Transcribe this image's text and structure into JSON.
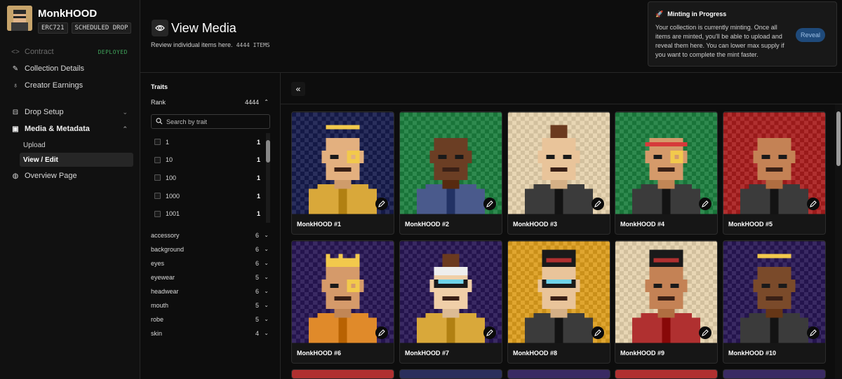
{
  "brand": {
    "name": "MonkHOOD",
    "tags": [
      "ERC721",
      "SCHEDULED DROP"
    ]
  },
  "nav": {
    "contract": {
      "label": "Contract",
      "badge": "DEPLOYED"
    },
    "collection_details": "Collection Details",
    "creator_earnings": "Creator Earnings",
    "drop_setup": "Drop Setup",
    "media_metadata": "Media & Metadata",
    "upload": "Upload",
    "view_edit": "View / Edit",
    "overview_page": "Overview Page"
  },
  "header": {
    "title": "View Media",
    "subtitle": "Review individual items here.",
    "item_count": "4444 ITEMS"
  },
  "mint_notice": {
    "title": "Minting in Progress",
    "text": "Your collection is currently minting. Once all items are minted, you'll be able to upload and reveal them here. You can lower max supply if you want to complete the mint faster.",
    "button": "Reveal"
  },
  "traits": {
    "title": "Traits",
    "rank": {
      "label": "Rank",
      "count": "4444"
    },
    "search_placeholder": "Search by trait",
    "rank_options": [
      {
        "label": "1",
        "count": "1"
      },
      {
        "label": "10",
        "count": "1"
      },
      {
        "label": "100",
        "count": "1"
      },
      {
        "label": "1000",
        "count": "1"
      },
      {
        "label": "1001",
        "count": "1"
      }
    ],
    "categories": [
      {
        "label": "accessory",
        "count": "6"
      },
      {
        "label": "background",
        "count": "6"
      },
      {
        "label": "eyes",
        "count": "6"
      },
      {
        "label": "eyewear",
        "count": "5"
      },
      {
        "label": "headwear",
        "count": "6"
      },
      {
        "label": "mouth",
        "count": "5"
      },
      {
        "label": "robe",
        "count": "5"
      },
      {
        "label": "skin",
        "count": "4"
      }
    ]
  },
  "items": [
    {
      "name": "MonkHOOD #1",
      "bg": "#2a2f5c",
      "skin": "#e3b07f",
      "robe": "#d9a83a",
      "head": "halo",
      "eyewear": "monocle"
    },
    {
      "name": "MonkHOOD #2",
      "bg": "#2f8a4f",
      "skin": "#6b3e24",
      "robe": "#4a5a8c",
      "head": "none",
      "eyewear": "none"
    },
    {
      "name": "MonkHOOD #3",
      "bg": "#e8d6b4",
      "skin": "#e9c49a",
      "robe": "#3b3b3b",
      "head": "bun",
      "eyewear": "none"
    },
    {
      "name": "MonkHOOD #4",
      "bg": "#2f8a4f",
      "skin": "#d59a6a",
      "robe": "#3b3b3b",
      "head": "headband",
      "eyewear": "monocle"
    },
    {
      "name": "MonkHOOD #5",
      "bg": "#b03030",
      "skin": "#c48255",
      "robe": "#3b3b3b",
      "head": "none",
      "eyewear": "none"
    },
    {
      "name": "MonkHOOD #6",
      "bg": "#3a2a63",
      "skin": "#d59a6a",
      "robe": "#e08a2a",
      "head": "crown",
      "eyewear": "monocle"
    },
    {
      "name": "MonkHOOD #7",
      "bg": "#3a2a63",
      "skin": "#f0cfa8",
      "robe": "#d9a83a",
      "head": "band",
      "eyewear": "visor"
    },
    {
      "name": "MonkHOOD #8",
      "bg": "#e0a630",
      "skin": "#e9c49a",
      "robe": "#3b3b3b",
      "head": "tophat",
      "eyewear": "visor"
    },
    {
      "name": "MonkHOOD #9",
      "bg": "#e8d6b4",
      "skin": "#c48255",
      "robe": "#b03030",
      "head": "tophat",
      "eyewear": "none"
    },
    {
      "name": "MonkHOOD #10",
      "bg": "#3a2a63",
      "skin": "#7a4a2a",
      "robe": "#3b3b3b",
      "head": "halo",
      "eyewear": "none"
    }
  ],
  "peek_colors": [
    "#b03030",
    "#2a2f5c",
    "#3a2a63",
    "#b03030",
    "#3a2a63"
  ]
}
